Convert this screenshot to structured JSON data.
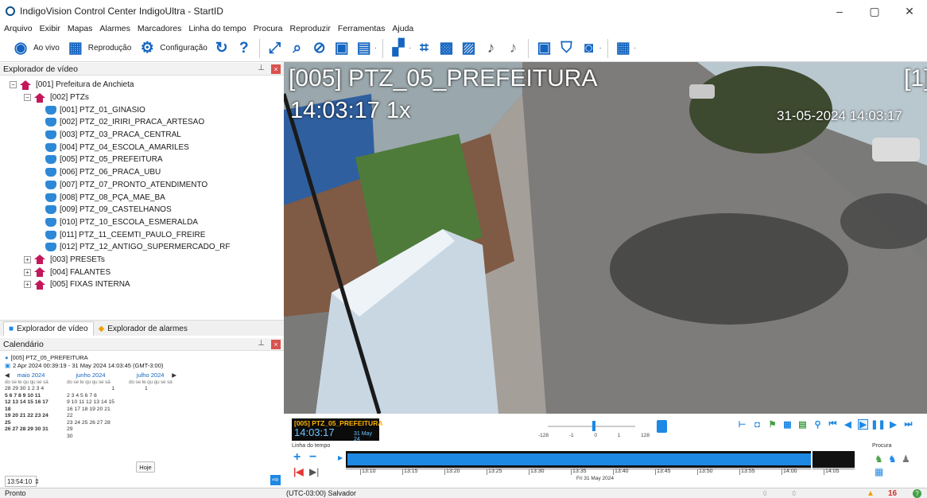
{
  "window": {
    "title": "IndigoVision Control Center IndigoUltra - StartID",
    "minimize": "–",
    "maximize": "▢",
    "close": "✕"
  },
  "menu": [
    "Arquivo",
    "Exibir",
    "Mapas",
    "Alarmes",
    "Marcadores",
    "Linha do tempo",
    "Procura",
    "Reproduzir",
    "Ferramentas",
    "Ajuda"
  ],
  "toolbar": {
    "live_label": "Ao vivo",
    "playback_label": "Reprodução",
    "config_label": "Configuração"
  },
  "explorer": {
    "title": "Explorador de vídeo",
    "root": "[001] Prefeitura de Anchieta",
    "group_ptz": "[002] PTZs",
    "cameras": [
      "[001] PTZ_01_GINASIO",
      "[002] PTZ_02_IRIRI_PRACA_ARTESAO",
      "[003] PTZ_03_PRACA_CENTRAL",
      "[004] PTZ_04_ESCOLA_AMARILES",
      "[005] PTZ_05_PREFEITURA",
      "[006] PTZ_06_PRACA_UBU",
      "[007] PTZ_07_PRONTO_ATENDIMENTO",
      "[008] PTZ_08_PÇA_MAE_BA",
      "[009] PTZ_09_CASTELHANOS",
      "[010] PTZ_10_ESCOLA_ESMERALDA",
      "[011] PTZ_11_CEEMTI_PAULO_FREIRE",
      "[012] PTZ_12_ANTIGO_SUPERMERCADO_RF"
    ],
    "groups": [
      "[003] PRESETs",
      "[004] FALANTES",
      "[005] FIXAS INTERNA"
    ],
    "tab_video": "Explorador de vídeo",
    "tab_alarms": "Explorador de alarmes"
  },
  "calendar": {
    "title": "Calendário",
    "camera": "[005] PTZ_05_PREFEITURA",
    "range": "2 Apr 2024 00:39:19 - 31 May 2024 14:03:45 (GMT-3:00)",
    "weekdays": "do se te qu qu se sá",
    "months": [
      {
        "name": "maio 2024",
        "rows": [
          "28 29 30 1 2 3 4",
          "5 6 7 8 9 10 11",
          "12 13 14 15 16 17 18",
          "19 20 21 22 23 24 25",
          "26 27 28 29 30 31"
        ]
      },
      {
        "name": "junho 2024",
        "rows": [
          "1",
          "2 3 4 5 6 7 8",
          "9 10 11 12 13 14 15",
          "16 17 18 19 20 21 22",
          "23 24 25 26 27 28 29",
          "30"
        ]
      },
      {
        "name": "julho 2024",
        "rows": [
          "1"
        ]
      }
    ],
    "today_label": "Hoje",
    "time_value": "13:54:10"
  },
  "video": {
    "camera_label": "[005] PTZ_05_PREFEITURA",
    "time": "14:03:17 1x",
    "stamp": "31-05-2024 14:03:17",
    "index": "[1]"
  },
  "playback": {
    "osd_name": "[005] PTZ_05_PREFEITURA",
    "osd_time": "14:03:17",
    "osd_date": "31 May 24",
    "speed_ticks": [
      "-128",
      "-1",
      "0",
      "1",
      "128"
    ],
    "timeline_label": "Linha do tempo",
    "ticks": [
      "13:10",
      "13:15",
      "13:20",
      "13:25",
      "13:30",
      "13:35",
      "13:40",
      "13:45",
      "13:50",
      "13:55",
      "14:00",
      "14:05"
    ],
    "date_label": "Fri 31 May 2024",
    "search_label": "Procura"
  },
  "status": {
    "left": "Pronto",
    "timezone": "(UTC-03:00) Salvador",
    "count0a": "0",
    "count0b": "0",
    "alarms": "16"
  }
}
